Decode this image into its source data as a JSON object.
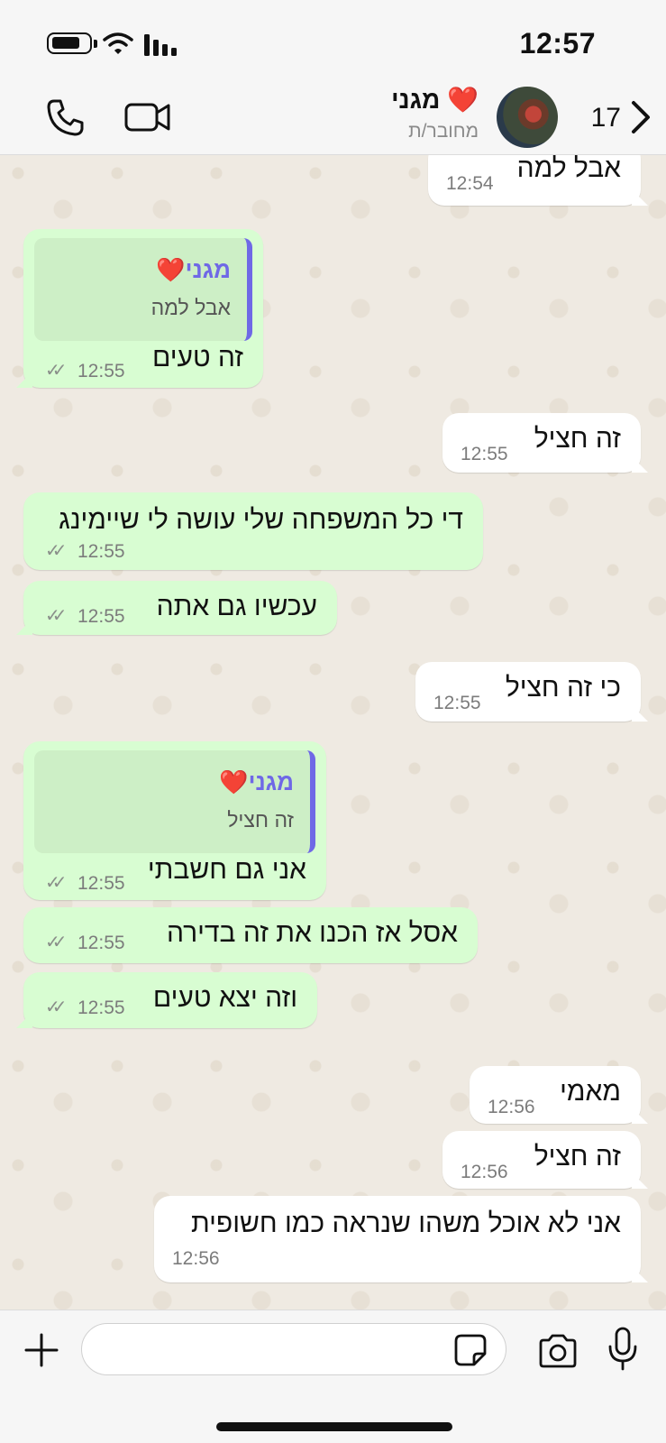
{
  "status_bar": {
    "time": "12:57"
  },
  "header": {
    "unread_count": "17",
    "contact_name": "מגני",
    "contact_status": "מחובר/ת",
    "heart": "❤️"
  },
  "messages": [
    {
      "dir": "in",
      "text": "אבל למה",
      "time": "12:54"
    },
    {
      "dir": "out",
      "quote_name": "מגני",
      "quote_text": "אבל למה",
      "text": "זה טעים",
      "time": "12:55",
      "ticks": "✓✓"
    },
    {
      "dir": "in",
      "text": "זה חציל",
      "time": "12:55"
    },
    {
      "dir": "out",
      "text": "די כל המשפחה שלי עושה לי שיימינג",
      "time": "12:55",
      "ticks": "✓✓"
    },
    {
      "dir": "out",
      "text": "עכשיו גם אתה",
      "time": "12:55",
      "ticks": "✓✓"
    },
    {
      "dir": "in",
      "text": "כי זה חציל",
      "time": "12:55"
    },
    {
      "dir": "out",
      "quote_name": "מגני",
      "quote_text": "זה חציל",
      "text": "אני גם חשבתי",
      "time": "12:55",
      "ticks": "✓✓"
    },
    {
      "dir": "out",
      "text": "אסל אז הכנו את זה בדירה",
      "time": "12:55",
      "ticks": "✓✓"
    },
    {
      "dir": "out",
      "text": "וזה יצא טעים",
      "time": "12:55",
      "ticks": "✓✓"
    },
    {
      "dir": "in",
      "text": "מאמי",
      "time": "12:56"
    },
    {
      "dir": "in",
      "text": "זה חציל",
      "time": "12:56"
    },
    {
      "dir": "in",
      "text": "אני לא אוכל משהו שנראה כמו חשופית",
      "time": "12:56"
    }
  ],
  "composer": {
    "placeholder": ""
  },
  "colors": {
    "outgoing_bubble": "#d8fdd2",
    "incoming_bubble": "#ffffff",
    "quote_accent": "#6f68e6",
    "chat_background": "#efeae2"
  },
  "icons": [
    "battery-icon",
    "wifi-icon",
    "signal-icon",
    "phone-icon",
    "video-icon",
    "back-chevron-icon",
    "plus-icon",
    "sticker-icon",
    "camera-icon",
    "microphone-icon"
  ]
}
